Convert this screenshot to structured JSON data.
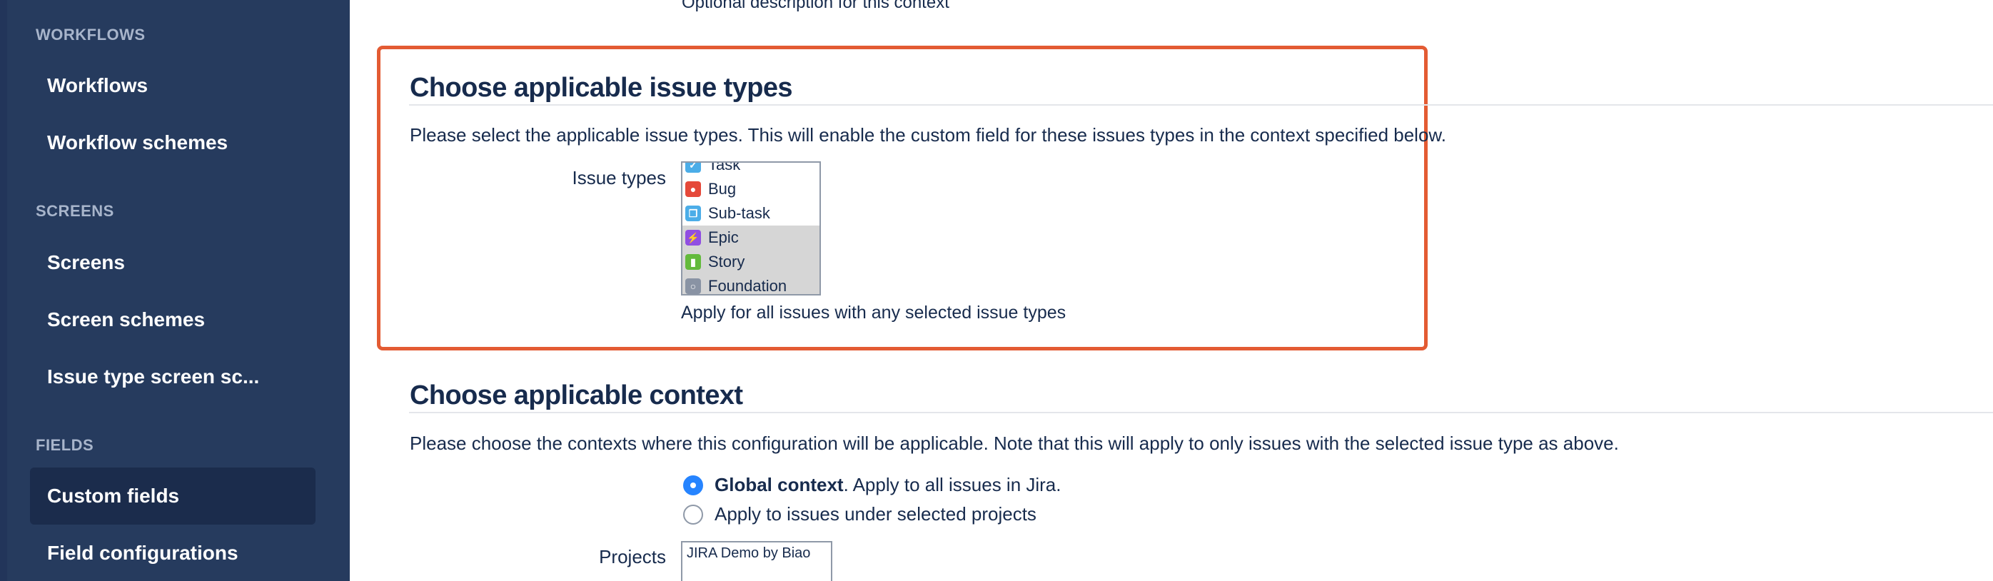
{
  "sidebar": {
    "sections": [
      {
        "heading": "WORKFLOWS",
        "items": [
          "Workflows",
          "Workflow schemes"
        ]
      },
      {
        "heading": "SCREENS",
        "items": [
          "Screens",
          "Screen schemes",
          "Issue type screen sc..."
        ]
      },
      {
        "heading": "FIELDS",
        "items": [
          "Custom fields",
          "Field configurations"
        ]
      }
    ],
    "active_item": "Custom fields"
  },
  "main": {
    "top_description": "Optional description for this context",
    "issue_types_section": {
      "title": "Choose applicable issue types",
      "description": "Please select the applicable issue types. This will enable the custom field for these issues types in the context specified below.",
      "field_label": "Issue types",
      "options": [
        {
          "label": "Task",
          "icon": "task-icon",
          "color": "#4bade8",
          "selected": false
        },
        {
          "label": "Bug",
          "icon": "bug-icon",
          "color": "#e5493a",
          "selected": false
        },
        {
          "label": "Sub-task",
          "icon": "subtask-icon",
          "color": "#4bade8",
          "selected": false
        },
        {
          "label": "Epic",
          "icon": "epic-icon",
          "color": "#904ee2",
          "selected": true
        },
        {
          "label": "Story",
          "icon": "story-icon",
          "color": "#63ba3c",
          "selected": true
        },
        {
          "label": "Foundation",
          "icon": "foundation-icon",
          "color": "#8993a4",
          "selected": true
        }
      ],
      "helper_text": "Apply for all issues with any selected issue types"
    },
    "context_section": {
      "title": "Choose applicable context",
      "description": "Please choose the contexts where this configuration will be applicable. Note that this will apply to only issues with the selected issue type as above.",
      "global_option_bold": "Global context",
      "global_option_rest": ". Apply to all issues in Jira.",
      "projects_option": "Apply to issues under selected projects",
      "projects_label": "Projects",
      "projects_list": [
        "JIRA Demo by Biao"
      ]
    }
  },
  "colors": {
    "sidebar_bg": "#263b5e",
    "highlight_border": "#e35b33",
    "radio_checked": "#2684ff"
  }
}
